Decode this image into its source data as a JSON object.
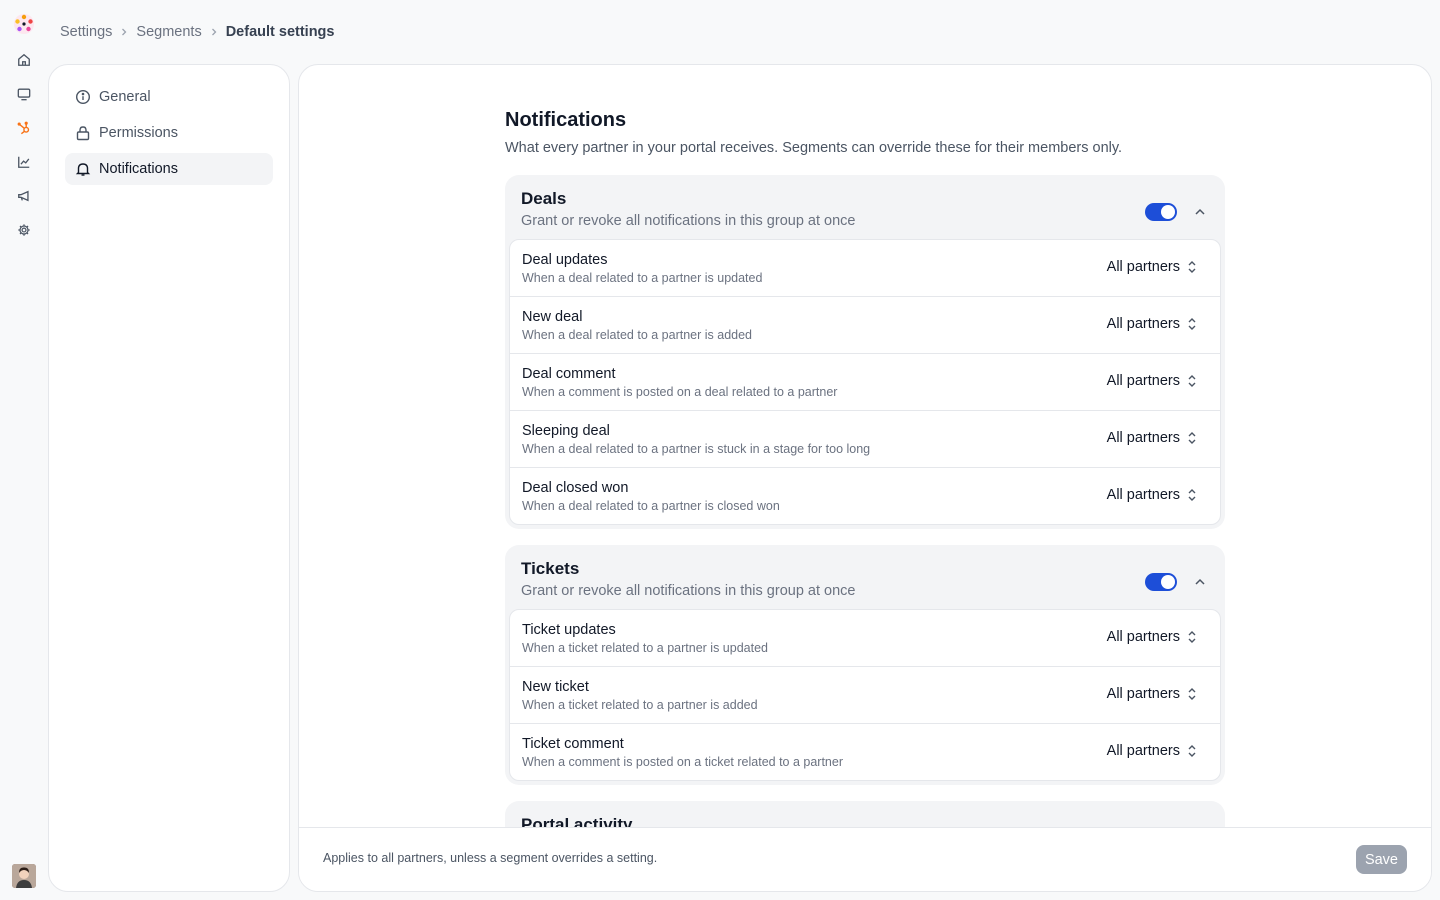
{
  "app": {
    "accent_color": "#1d4ed8",
    "logo_icon": "brand-logo-icon"
  },
  "rail": {
    "items": [
      {
        "icon": "home-icon"
      },
      {
        "icon": "monitor-icon"
      },
      {
        "icon": "hubspot-icon"
      },
      {
        "icon": "chart-icon"
      },
      {
        "icon": "megaphone-icon"
      },
      {
        "icon": "gear-icon"
      }
    ]
  },
  "breadcrumb": {
    "items": [
      "Settings",
      "Segments"
    ],
    "current": "Default settings"
  },
  "sidebar": {
    "items": [
      {
        "label": "General",
        "icon": "info-icon"
      },
      {
        "label": "Permissions",
        "icon": "lock-icon"
      },
      {
        "label": "Notifications",
        "icon": "bell-icon",
        "active": true
      }
    ]
  },
  "main": {
    "title": "Notifications",
    "description": "What every partner in your portal receives. Segments can override these for their members only.",
    "groups": [
      {
        "title": "Deals",
        "description": "Grant or revoke all notifications in this group at once",
        "enabled": true,
        "rows": [
          {
            "title": "Deal updates",
            "description": "When a deal related to a partner is updated",
            "value": "All partners"
          },
          {
            "title": "New deal",
            "description": "When a deal related to a partner is added",
            "value": "All partners"
          },
          {
            "title": "Deal comment",
            "description": "When a comment is posted on a deal related to a partner",
            "value": "All partners"
          },
          {
            "title": "Sleeping deal",
            "description": "When a deal related to a partner is stuck in a stage for too long",
            "value": "All partners"
          },
          {
            "title": "Deal closed won",
            "description": "When a deal related to a partner is closed won",
            "value": "All partners"
          }
        ]
      },
      {
        "title": "Tickets",
        "description": "Grant or revoke all notifications in this group at once",
        "enabled": true,
        "rows": [
          {
            "title": "Ticket updates",
            "description": "When a ticket related to a partner is updated",
            "value": "All partners"
          },
          {
            "title": "New ticket",
            "description": "When a ticket related to a partner is added",
            "value": "All partners"
          },
          {
            "title": "Ticket comment",
            "description": "When a comment is posted on a ticket related to a partner",
            "value": "All partners"
          }
        ]
      },
      {
        "title": "Portal activity",
        "description": "",
        "enabled": true,
        "rows": []
      }
    ]
  },
  "footer": {
    "note": "Applies to all partners, unless a segment overrides a setting.",
    "save_label": "Save"
  }
}
